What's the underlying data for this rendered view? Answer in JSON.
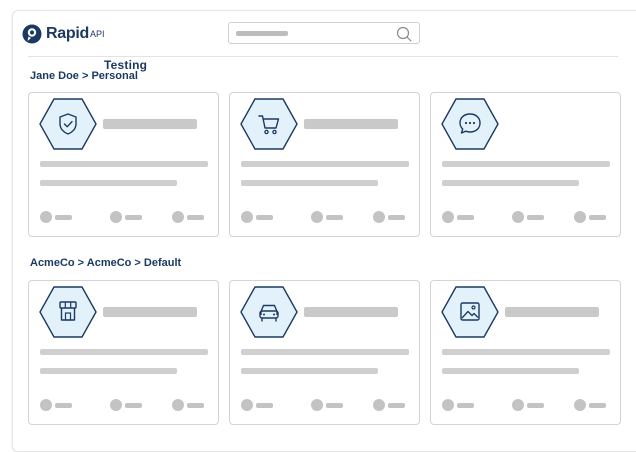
{
  "header": {
    "logo_text": "Rapid",
    "logo_suffix": "API",
    "team_name": "Testing"
  },
  "search": {
    "placeholder": ""
  },
  "sections": [
    {
      "breadcrumb": "Jane Doe > Personal",
      "cards": [
        {
          "icon": "shield-check-icon"
        },
        {
          "icon": "shopping-cart-icon"
        },
        {
          "icon": "chat-bubble-icon"
        }
      ]
    },
    {
      "breadcrumb": "AcmeCo > AcmeCo > Default",
      "cards": [
        {
          "icon": "storefront-icon"
        },
        {
          "icon": "car-icon"
        },
        {
          "icon": "image-icon"
        }
      ]
    }
  ],
  "colors": {
    "brand": "#1b3a63",
    "hex_fill": "#e3f2fa",
    "skeleton": "#c9c9c9"
  }
}
